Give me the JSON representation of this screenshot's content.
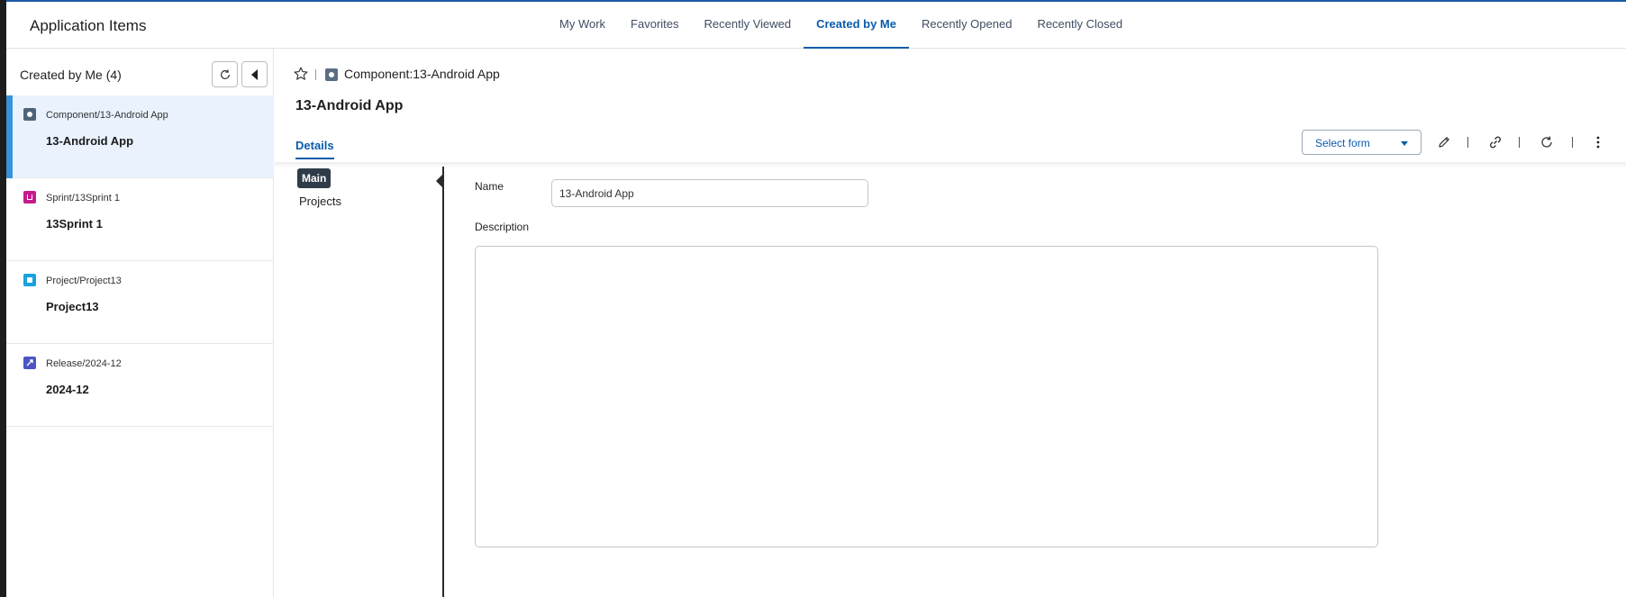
{
  "header": {
    "app_title": "Application Items",
    "tabs": [
      {
        "label": "My Work",
        "active": false
      },
      {
        "label": "Favorites",
        "active": false
      },
      {
        "label": "Recently Viewed",
        "active": false
      },
      {
        "label": "Created by Me",
        "active": true
      },
      {
        "label": "Recently Opened",
        "active": false
      },
      {
        "label": "Recently Closed",
        "active": false
      }
    ]
  },
  "sidebar": {
    "title": "Created by Me (4)",
    "items": [
      {
        "path": "Component/13-Android App",
        "name": "13-Android App",
        "icon": "component-icon",
        "color": "#4f6478",
        "selected": true
      },
      {
        "path": "Sprint/13Sprint 1",
        "name": "13Sprint 1",
        "icon": "sprint-icon",
        "color": "#c71a8e",
        "selected": false
      },
      {
        "path": "Project/Project13",
        "name": "Project13",
        "icon": "project-icon",
        "color": "#1aa2dd",
        "selected": false
      },
      {
        "path": "Release/2024-12",
        "name": "2024-12",
        "icon": "release-icon",
        "color": "#4a55c2",
        "selected": false
      }
    ]
  },
  "main": {
    "breadcrumb": "Component:13-Android App",
    "title": "13-Android App",
    "details_tab": "Details",
    "select_form_label": "Select form",
    "sub_nav": {
      "main": "Main",
      "projects": "Projects"
    },
    "form": {
      "name_label": "Name",
      "name_value": "13-Android App",
      "description_label": "Description",
      "description_value": ""
    }
  },
  "colors": {
    "accent": "#0b5cab",
    "selected_bg": "#e9f2fd",
    "selected_bar": "#3a93d6"
  }
}
